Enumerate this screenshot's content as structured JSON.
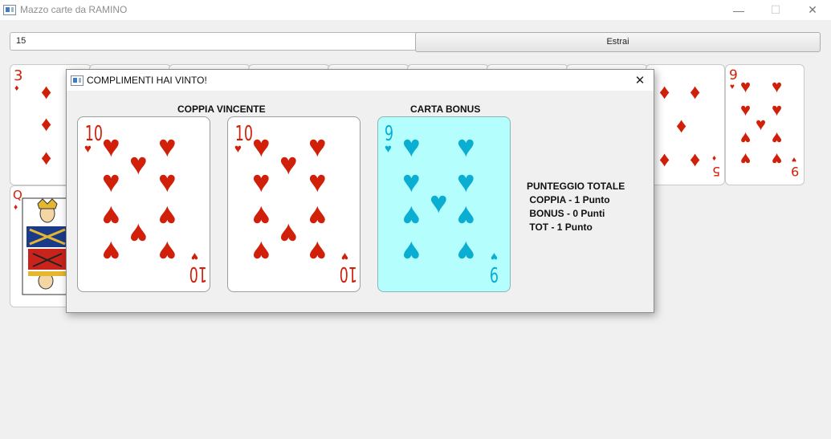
{
  "window": {
    "title": "Mazzo carte da RAMINO",
    "minimize": "—",
    "maximize": "☐",
    "close": "✕"
  },
  "toolbar": {
    "count_value": "15",
    "draw_label": "Estrai"
  },
  "table_cards": [
    {
      "rank": "3",
      "suit": "♦"
    },
    {
      "rank": "Q",
      "suit": "♦"
    },
    {
      "rank": "5",
      "suit": "♦"
    },
    {
      "rank": "9",
      "suit": "♥"
    }
  ],
  "dialog": {
    "title": "COMPLIMENTI HAI VINTO!",
    "close": "✕",
    "pair_heading": "COPPIA VINCENTE",
    "bonus_heading": "CARTA BONUS",
    "pair_cards": [
      {
        "rank": "10",
        "suit": "♥"
      },
      {
        "rank": "10",
        "suit": "♥"
      }
    ],
    "bonus_card": {
      "rank": "9",
      "suit": "♥"
    },
    "score": {
      "title": "PUNTEGGIO TOTALE",
      "pair_line": " COPPIA - 1 Punto",
      "bonus_line": " BONUS - 0 Punti",
      "total_line": " TOT - 1 Punto"
    }
  },
  "colors": {
    "red_suit": "#d1200a",
    "bonus_suit": "#0aaed2",
    "bonus_bg": "#b4fefe",
    "window_bg": "#f0f0f0"
  }
}
